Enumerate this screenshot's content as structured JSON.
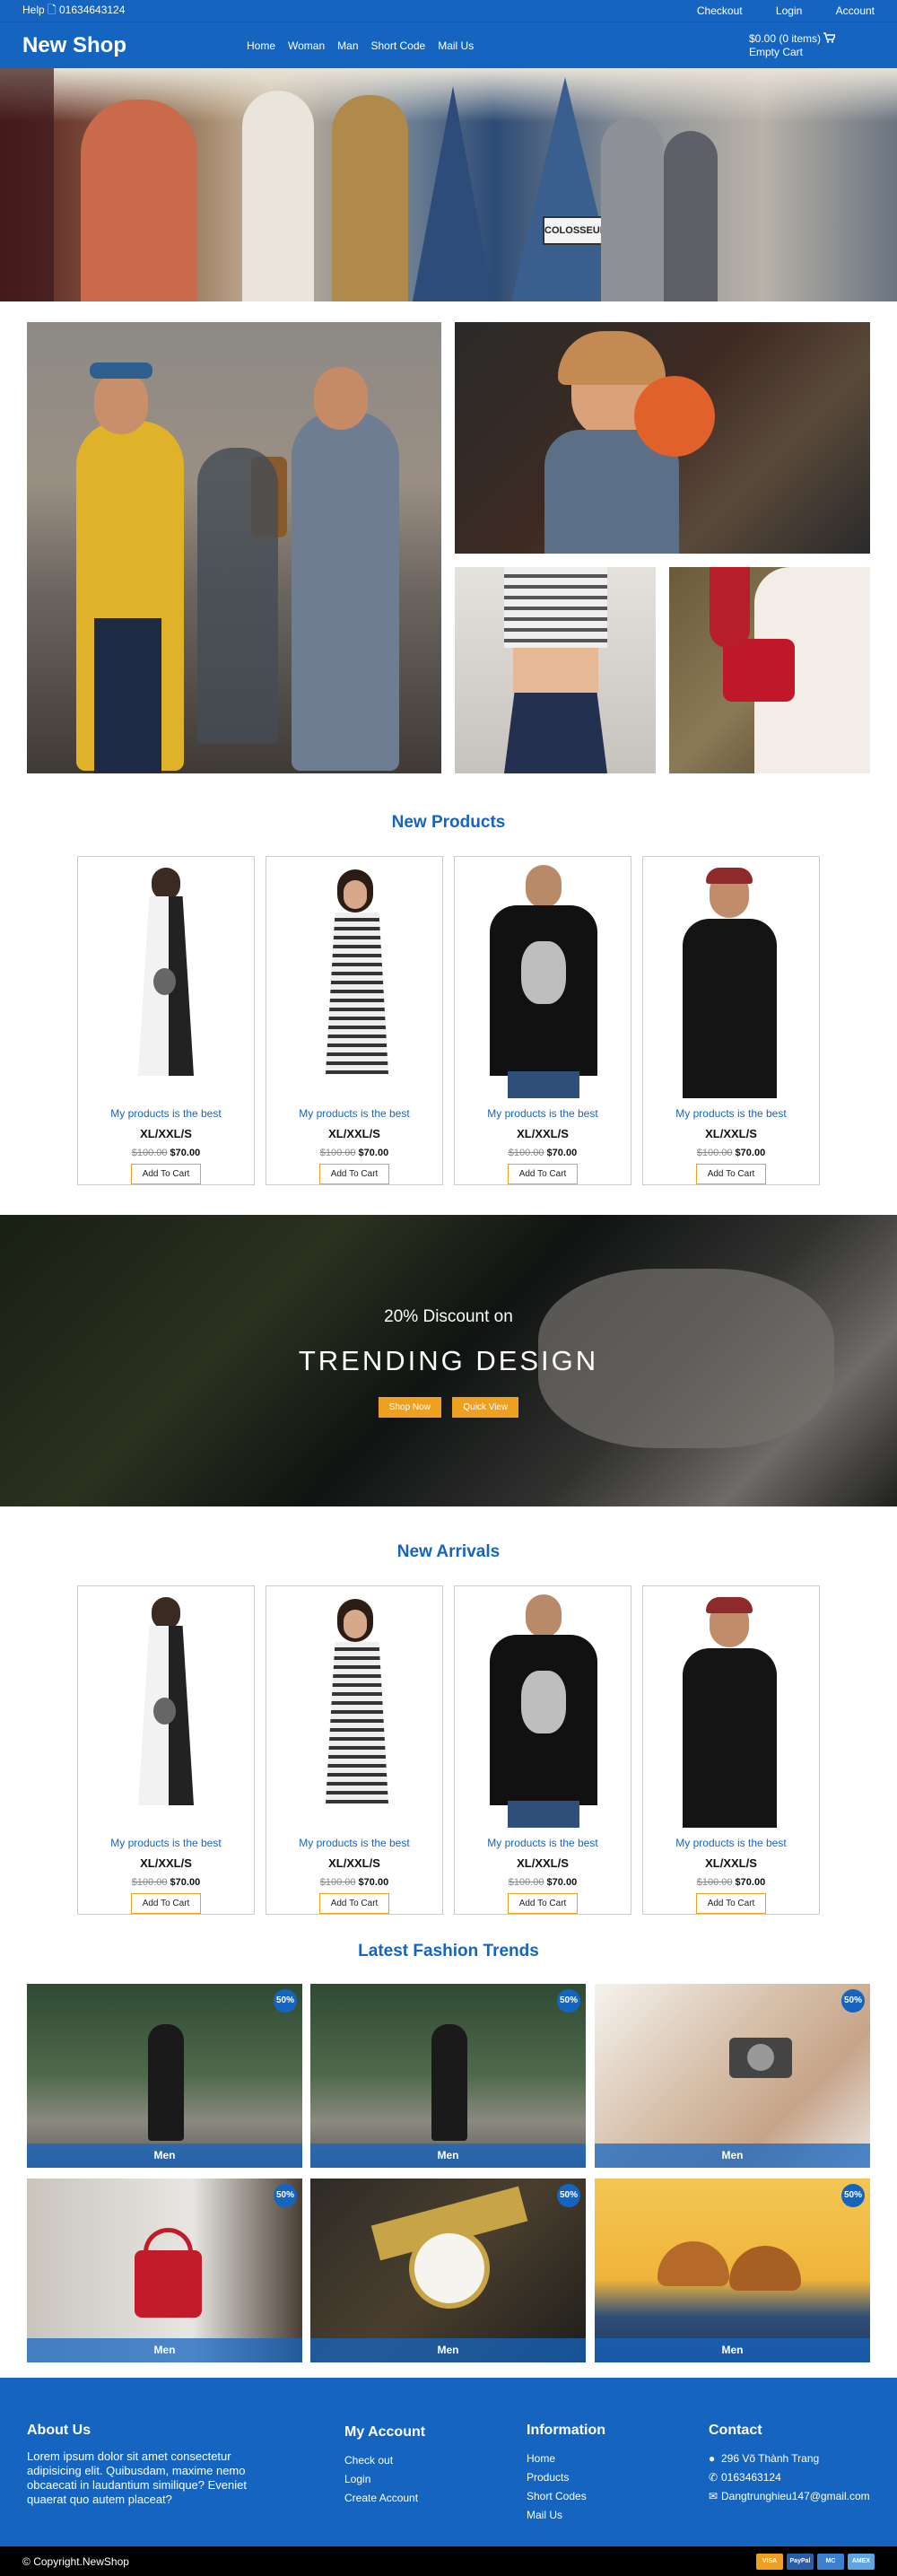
{
  "topbar": {
    "help_text": "Help 🗋 01634643124",
    "links": [
      "Checkout",
      "Login",
      "Account"
    ]
  },
  "navbar": {
    "brand": "New Shop",
    "menu": [
      "Home",
      "Woman",
      "Man",
      "Short Code",
      "Mail Us"
    ],
    "cart_total": "$0.00 (0 items)",
    "cart_status": "Empty Cart"
  },
  "new_products": {
    "title": "New Products",
    "items": [
      {
        "name": "My products is the best",
        "sizes": "XL/XXL/S",
        "old_price": "$100.00",
        "price": "$70.00",
        "button": "Add To Cart",
        "image": "dress-print"
      },
      {
        "name": "My products is the best",
        "sizes": "XL/XXL/S",
        "old_price": "$100.00",
        "price": "$70.00",
        "button": "Add To Cart",
        "image": "dress-stripes"
      },
      {
        "name": "My products is the best",
        "sizes": "XL/XXL/S",
        "old_price": "$100.00",
        "price": "$70.00",
        "button": "Add To Cart",
        "image": "tshirt-black-print"
      },
      {
        "name": "My products is the best",
        "sizes": "XL/XXL/S",
        "old_price": "$100.00",
        "price": "$70.00",
        "button": "Add To Cart",
        "image": "tshirt-black"
      }
    ]
  },
  "banner": {
    "subtitle": "20% Discount on",
    "title": "TRENDING DESIGN",
    "btn_shop": "Shop Now",
    "btn_view": "Quick View"
  },
  "new_arrivals": {
    "title": "New Arrivals",
    "items": [
      {
        "name": "My products is the best",
        "sizes": "XL/XXL/S",
        "old_price": "$100.00",
        "price": "$70.00",
        "button": "Add To Cart",
        "image": "dress-print"
      },
      {
        "name": "My products is the best",
        "sizes": "XL/XXL/S",
        "old_price": "$100.00",
        "price": "$70.00",
        "button": "Add To Cart",
        "image": "dress-stripes"
      },
      {
        "name": "My products is the best",
        "sizes": "XL/XXL/S",
        "old_price": "$100.00",
        "price": "$70.00",
        "button": "Add To Cart",
        "image": "tshirt-black-print"
      },
      {
        "name": "My products is the best",
        "sizes": "XL/XXL/S",
        "old_price": "$100.00",
        "price": "$70.00",
        "button": "Add To Cart",
        "image": "tshirt-black"
      }
    ]
  },
  "trends": {
    "title": "Latest Fashion Trends",
    "items": [
      {
        "label": "Men",
        "badge": "50%"
      },
      {
        "label": "Men",
        "badge": "50%"
      },
      {
        "label": "Men",
        "badge": "50%"
      },
      {
        "label": "Men",
        "badge": "50%"
      },
      {
        "label": "Men",
        "badge": "50%"
      },
      {
        "label": "Men",
        "badge": "50%"
      }
    ]
  },
  "footer": {
    "about_title": "About Us",
    "about_text": "Lorem ipsum dolor sit amet consectetur adipisicing elit. Quibusdam, maxime nemo obcaecati in laudantium similique? Eveniet quaerat quo autem placeat?",
    "account_title": "My Account",
    "account_links": [
      "Check out",
      "Login",
      "Create Account"
    ],
    "info_title": "Information",
    "info_links": [
      "Home",
      "Products",
      "Short Codes",
      "Mail Us"
    ],
    "contact_title": "Contact",
    "contact_address": "296 Võ Thành Trang",
    "contact_phone": "0163463124",
    "contact_email": "Dangtrunghieu147@gmail.com"
  },
  "copyright": "Copyright.NewShop",
  "payments": [
    "VISA",
    "PayPal",
    "MC",
    "AMEX"
  ],
  "colors": {
    "primary": "#1565c0",
    "accent": "#f0a020",
    "footer_bottom": "#000000"
  }
}
